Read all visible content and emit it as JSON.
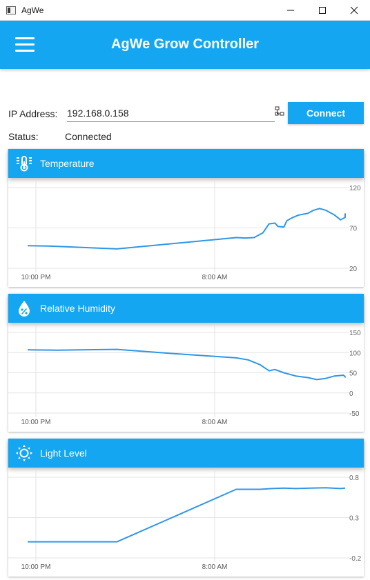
{
  "window": {
    "title": "AgWe"
  },
  "appbar": {
    "title": "AgWe Grow Controller"
  },
  "connection": {
    "ip_label": "IP Address:",
    "ip_value": "192.168.0.158",
    "connect_label": "Connect",
    "status_label": "Status:",
    "status_value": "Connected"
  },
  "colors": {
    "accent": "#14a6f0",
    "line": "#2f96e6",
    "grid": "#e3e3e3"
  },
  "icons": {
    "menu": "hamburger-menu-icon",
    "network": "network-icon",
    "temperature": "thermometer-icon",
    "humidity": "water-drop-percent-icon",
    "light": "sun-icon"
  },
  "cards": [
    {
      "title": "Temperature"
    },
    {
      "title": "Relative Humidity"
    },
    {
      "title": "Light Level"
    }
  ],
  "chart_data": [
    {
      "type": "line",
      "title": "Temperature",
      "x_tick_labels": [
        "10:00 PM",
        "8:00 AM"
      ],
      "ylim": [
        20,
        120
      ],
      "y_ticks": [
        120,
        70,
        20
      ],
      "grid": true,
      "points": [
        [
          0,
          48
        ],
        [
          0.07,
          47.5
        ],
        [
          0.3,
          44
        ],
        [
          0.7,
          58
        ],
        [
          0.73,
          57.5
        ],
        [
          0.76,
          58
        ],
        [
          0.79,
          64
        ],
        [
          0.81,
          75
        ],
        [
          0.83,
          76
        ],
        [
          0.84,
          72
        ],
        [
          0.86,
          71
        ],
        [
          0.87,
          79
        ],
        [
          0.89,
          83
        ],
        [
          0.91,
          86
        ],
        [
          0.94,
          88
        ],
        [
          0.96,
          92
        ],
        [
          0.98,
          94
        ],
        [
          1.0,
          92
        ],
        [
          1.03,
          86
        ],
        [
          1.05,
          80
        ],
        [
          1.07,
          83
        ],
        [
          1.09,
          88
        ],
        [
          1.1,
          88
        ]
      ]
    },
    {
      "type": "line",
      "title": "Relative Humidity",
      "x_tick_labels": [
        "10:00 PM",
        "8:00 AM"
      ],
      "ylim": [
        -50,
        150
      ],
      "y_ticks": [
        150,
        100,
        50,
        0,
        -50
      ],
      "grid": true,
      "points": [
        [
          0,
          107
        ],
        [
          0.1,
          106
        ],
        [
          0.3,
          108
        ],
        [
          0.5,
          97
        ],
        [
          0.7,
          87
        ],
        [
          0.74,
          82
        ],
        [
          0.78,
          70
        ],
        [
          0.81,
          55
        ],
        [
          0.83,
          58
        ],
        [
          0.86,
          50
        ],
        [
          0.9,
          42
        ],
        [
          0.94,
          38
        ],
        [
          0.97,
          33
        ],
        [
          1.0,
          36
        ],
        [
          1.03,
          42
        ],
        [
          1.06,
          44
        ],
        [
          1.08,
          40
        ],
        [
          1.1,
          38
        ]
      ]
    },
    {
      "type": "line",
      "title": "Light Level",
      "x_tick_labels": [
        "10:00 PM",
        "8:00 AM"
      ],
      "ylim": [
        -0.2,
        0.8
      ],
      "y_ticks": [
        0.8,
        0.3,
        -0.2
      ],
      "grid": true,
      "points": [
        [
          0,
          0
        ],
        [
          0.3,
          0
        ],
        [
          0.7,
          0.65
        ],
        [
          0.78,
          0.65
        ],
        [
          0.82,
          0.66
        ],
        [
          0.86,
          0.665
        ],
        [
          0.9,
          0.66
        ],
        [
          0.95,
          0.665
        ],
        [
          1.0,
          0.67
        ],
        [
          1.05,
          0.66
        ],
        [
          1.1,
          0.665
        ]
      ]
    }
  ]
}
